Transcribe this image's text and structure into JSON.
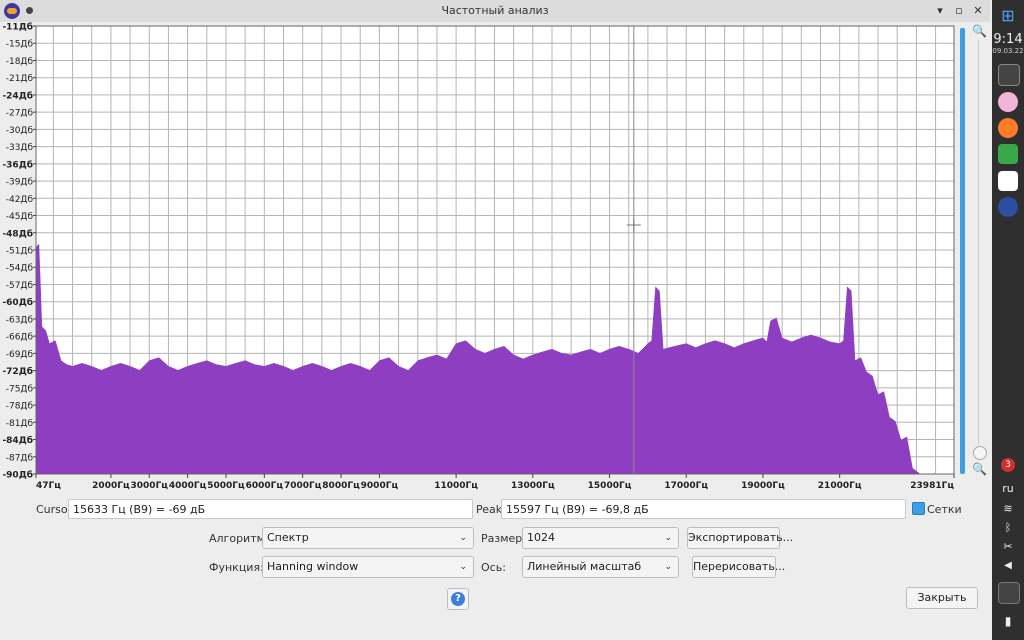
{
  "window": {
    "title": "Частотный анализ",
    "minimize": "▾",
    "maximize": "▫",
    "close": "✕"
  },
  "plot": {
    "y_labels": [
      "-11Дб",
      "-15Дб",
      "-18Дб",
      "-21Дб",
      "-24Дб",
      "-27Дб",
      "-30Дб",
      "-33Дб",
      "-36Дб",
      "-39Дб",
      "-42Дб",
      "-45Дб",
      "-48Дб",
      "-51Дб",
      "-54Дб",
      "-57Дб",
      "-60Дб",
      "-63Дб",
      "-66Дб",
      "-69Дб",
      "-72Дб",
      "-75Дб",
      "-78Дб",
      "-81Дб",
      "-84Дб",
      "-87Дб",
      "-90Дб"
    ],
    "y_bold": [
      "-11Дб",
      "-24Дб",
      "-36Дб",
      "-48Дб",
      "-60Дб",
      "-72Дб",
      "-84Дб",
      "-90Дб"
    ],
    "x_labels": [
      "47Гц",
      "2000Гц",
      "3000Гц",
      "4000Гц",
      "5000Гц",
      "6000Гц",
      "7000Гц",
      "8000Гц",
      "9000Гц",
      "11000Гц",
      "13000Гц",
      "15000Гц",
      "17000Гц",
      "19000Гц",
      "21000Гц",
      "23981Гц"
    ],
    "x_label_freqs": [
      47,
      2000,
      3000,
      4000,
      5000,
      6000,
      7000,
      8000,
      9000,
      11000,
      13000,
      15000,
      17000,
      19000,
      21000,
      23981
    ],
    "fill_color": "#8e3fc1",
    "grid_color": "#b5b5b5",
    "cursor_freq": 15633
  },
  "chart_data": {
    "type": "area",
    "xlabel": "",
    "ylabel": "",
    "xlim": [
      47,
      23981
    ],
    "ylim": [
      -90,
      -11
    ],
    "x": [
      47,
      200,
      400,
      700,
      1000,
      1500,
      2000,
      2500,
      3000,
      3500,
      4000,
      4500,
      5000,
      5500,
      6000,
      6500,
      7000,
      7500,
      8000,
      8500,
      9000,
      9500,
      10000,
      10500,
      11000,
      11500,
      12000,
      12500,
      13000,
      13500,
      14000,
      14500,
      15000,
      15500,
      16000,
      16200,
      16400,
      17000,
      17500,
      18000,
      18500,
      19000,
      19200,
      19500,
      20000,
      20500,
      21000,
      21200,
      21400,
      21700,
      22000,
      22300,
      22600,
      22900,
      23100,
      23300
    ],
    "y": [
      -50,
      -64,
      -67,
      -70,
      -71,
      -71,
      -71,
      -71,
      -70,
      -71,
      -71,
      -70,
      -71,
      -70,
      -71,
      -71,
      -71,
      -71,
      -71,
      -71,
      -70,
      -71,
      -70,
      -69,
      -67,
      -68,
      -68,
      -69,
      -69,
      -68,
      -69,
      -68,
      -68,
      -68,
      -67,
      -57,
      -68,
      -67,
      -67,
      -67,
      -67,
      -66,
      -63,
      -66,
      -66,
      -66,
      -67,
      -57,
      -70,
      -72,
      -76,
      -80,
      -84,
      -89,
      -90,
      -90
    ]
  },
  "bottom": {
    "cursor_label": "Cursor:",
    "cursor_value": "15633 Гц (B9) = -69 дБ",
    "peak_label": "Peak:",
    "peak_value": "15597 Гц (B9) = -69,8 дБ",
    "grids_label": "Сетки",
    "algorithm_label": "Алгоритм:",
    "algorithm_value": "Спектр",
    "size_label": "Размер:",
    "size_value": "1024",
    "export_button": "Экспортировать...",
    "function_label": "Функция:",
    "function_value": "Hanning window",
    "axis_label": "Ось:",
    "axis_value": "Линейный масштаб",
    "redraw_button": "Перерисовать...",
    "close_button": "Закрыть",
    "help_icon": "?"
  },
  "taskbar": {
    "time": "9:14",
    "date": "09.03.22",
    "lang": "ru",
    "badge": "3"
  }
}
